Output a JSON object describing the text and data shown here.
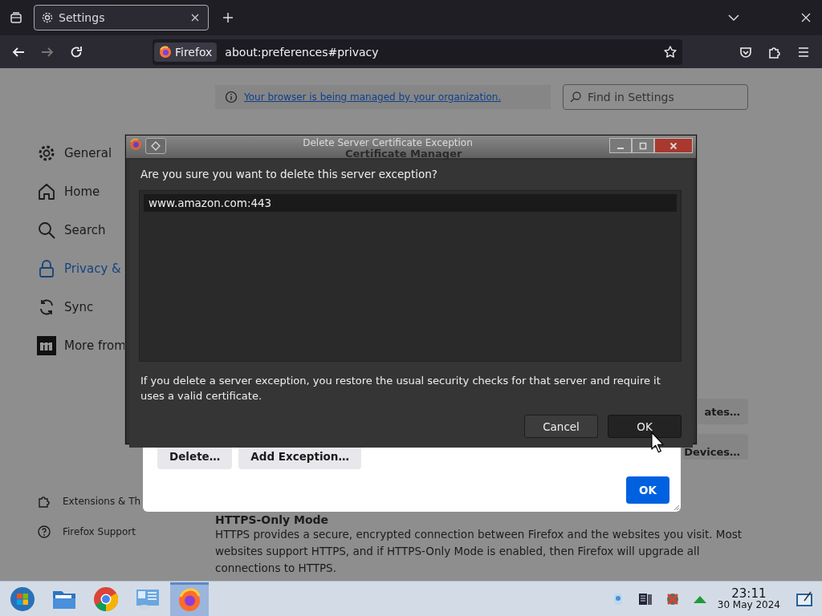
{
  "browser_tabs": [
    {
      "label": "Settings",
      "selected": true
    }
  ],
  "address_bar": {
    "identity": "Firefox",
    "url": "about:preferences#privacy"
  },
  "managed_notice": "Your browser is being managed by your organization.",
  "search": {
    "placeholder": "Find in Settings"
  },
  "sidebar": {
    "items": [
      {
        "label": "General",
        "kind": "gear",
        "selected": false
      },
      {
        "label": "Home",
        "kind": "home",
        "selected": false
      },
      {
        "label": "Search",
        "kind": "search",
        "selected": false
      },
      {
        "label": "Privacy &",
        "kind": "lock",
        "selected": true
      },
      {
        "label": "Sync",
        "kind": "sync",
        "selected": false
      },
      {
        "label": "More from",
        "kind": "mozilla",
        "selected": false
      }
    ],
    "footer": [
      {
        "label": "Extensions & Th",
        "kind": "puzzle"
      },
      {
        "label": "Firefox Support",
        "kind": "help"
      }
    ]
  },
  "page_buttons": [
    "ates…",
    "Devices…"
  ],
  "https_section": {
    "heading": "HTTPS-Only Mode",
    "text": "HTTPS provides a secure, encrypted connection between Firefox and the websites you visit. Most websites support HTTPS, and if HTTPS-Only Mode is enabled, then Firefox will upgrade all connections to HTTPS."
  },
  "certificate_manager": {
    "title": "Certificate Manager",
    "buttons": [
      {
        "label": "Delete…",
        "kind": "secondary"
      },
      {
        "label": "Add Exception…",
        "kind": "secondary"
      },
      {
        "label": "OK",
        "kind": "primary"
      }
    ]
  },
  "confirm_dialog": {
    "title": "Delete Server Certificate Exception",
    "question": "Are you sure you want to delete this server exception?",
    "items": [
      {
        "label": "www.amazon.com:443",
        "selected": true
      }
    ],
    "note": "If you delete a server exception, you restore the usual security checks for that server and require it uses a valid certificate.",
    "buttons": [
      {
        "label": "Cancel",
        "default": false
      },
      {
        "label": "OK",
        "default": true
      }
    ]
  },
  "taskbar": {
    "apps": [
      {
        "kind": "start",
        "active": false
      },
      {
        "kind": "folder",
        "active": false
      },
      {
        "kind": "chrome",
        "active": false
      },
      {
        "kind": "remote",
        "active": false
      },
      {
        "kind": "firefox",
        "active": true
      }
    ],
    "clock": {
      "time": "23:11",
      "date": "30 May 2024"
    }
  }
}
